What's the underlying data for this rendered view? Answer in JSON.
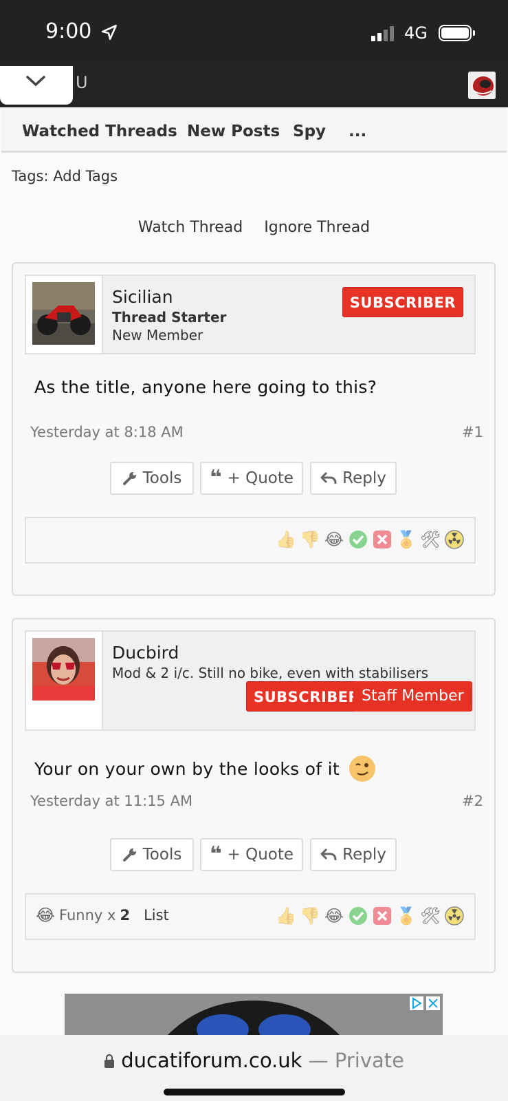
{
  "status_bar": {
    "time": "9:00",
    "network": "4G"
  },
  "header": {
    "letter": "U"
  },
  "nav": {
    "items": [
      "Watched Threads",
      "New Posts",
      "Spy",
      "..."
    ]
  },
  "tags_line": "Tags: Add Tags",
  "thread_actions": {
    "watch": "Watch Thread",
    "ignore": "Ignore Thread"
  },
  "posts": [
    {
      "username": "Sicilian",
      "role": "Thread Starter",
      "title": "New Member",
      "badge": "SUBSCRIBER",
      "message": "As the title, anyone here going to this?",
      "timestamp": "Yesterday at 8:18 AM",
      "number": "#1",
      "buttons": {
        "tools": "Tools",
        "quote": "+ Quote",
        "reply": "Reply"
      }
    },
    {
      "username": "Ducbird",
      "title": "Mod & 2 i/c. Still no bike, even with stabilisers",
      "badge": "SUBSCRIBER",
      "staff": "Staff Member",
      "message": "Your on your own by the looks of it",
      "timestamp": "Yesterday at 11:15 AM",
      "number": "#2",
      "buttons": {
        "tools": "Tools",
        "quote": "+ Quote",
        "reply": "Reply"
      },
      "reaction_summary": {
        "label": "Funny x",
        "count": "2",
        "list": "List"
      }
    }
  ],
  "reactions": [
    "like",
    "dislike",
    "funny",
    "agree",
    "disagree",
    "winner",
    "useful",
    "radioactive"
  ],
  "url_bar": {
    "domain": "ducatiforum.co.uk",
    "sep": " — ",
    "mode": "Private"
  },
  "colors": {
    "badge_red": "#e53224",
    "header_dark": "#232323"
  }
}
